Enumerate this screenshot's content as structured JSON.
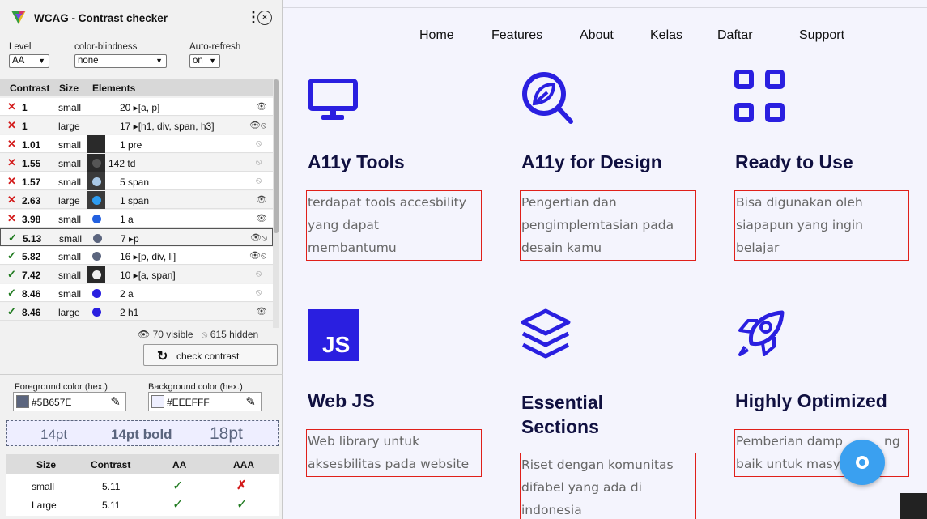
{
  "panel": {
    "title": "WCAG - Contrast checker",
    "level": {
      "label": "Level",
      "value": "AA"
    },
    "color_blindness": {
      "label": "color-blindness",
      "value": "none"
    },
    "auto_refresh": {
      "label": "Auto-refresh",
      "value": "on"
    },
    "columns": [
      "Contrast",
      "Size",
      "Elements"
    ],
    "rows": [
      {
        "status": "fail",
        "contrast": "1",
        "size": "small",
        "elements": "20 ▸[a, p]",
        "visibility": "visible"
      },
      {
        "status": "fail",
        "contrast": "1",
        "size": "large",
        "elements": "17 ▸[h1, div, span, h3]",
        "visibility": "both"
      },
      {
        "status": "fail",
        "contrast": "1.01",
        "size": "small",
        "elements": "1 pre",
        "visibility": "hidden"
      },
      {
        "status": "fail",
        "contrast": "1.55",
        "size": "small",
        "elements": "142 td",
        "visibility": "hidden"
      },
      {
        "status": "fail",
        "contrast": "1.57",
        "size": "small",
        "elements": "5 span",
        "visibility": "hidden"
      },
      {
        "status": "fail",
        "contrast": "2.63",
        "size": "large",
        "elements": "1 span",
        "visibility": "visible"
      },
      {
        "status": "fail",
        "contrast": "3.98",
        "size": "small",
        "elements": "1 a",
        "visibility": "visible"
      },
      {
        "status": "pass",
        "contrast": "5.13",
        "size": "small",
        "elements": "7 ▸p",
        "visibility": "both",
        "selected": true
      },
      {
        "status": "pass",
        "contrast": "5.82",
        "size": "small",
        "elements": "16 ▸[p, div, li]",
        "visibility": "both"
      },
      {
        "status": "pass",
        "contrast": "7.42",
        "size": "small",
        "elements": "10 ▸[a, span]",
        "visibility": "hidden"
      },
      {
        "status": "pass",
        "contrast": "8.46",
        "size": "small",
        "elements": "2 a",
        "visibility": "hidden"
      },
      {
        "status": "pass",
        "contrast": "8.46",
        "size": "large",
        "elements": "2 h1",
        "visibility": "visible"
      }
    ],
    "visible_count": "70 visible",
    "hidden_count": "615 hidden",
    "check_button": "check contrast",
    "foreground": {
      "label": "Foreground color (hex.)",
      "value": "#5B657E"
    },
    "background": {
      "label": "Background color (hex.)",
      "value": "#EEEFFF"
    },
    "preview": [
      "14pt",
      "14pt bold",
      "18pt"
    ],
    "result_columns": [
      "Size",
      "Contrast",
      "AA",
      "AAA"
    ],
    "results": [
      {
        "size": "small",
        "contrast": "5.11",
        "aa": "✓",
        "aaa": "✗"
      },
      {
        "size": "Large",
        "contrast": "5.11",
        "aa": "✓",
        "aaa": "✓"
      }
    ]
  },
  "site": {
    "nav": [
      "Home",
      "Features",
      "About",
      "Kelas",
      "Daftar",
      "Support"
    ],
    "cards": [
      {
        "icon": "monitor-icon",
        "title": "A11y Tools",
        "desc": [
          "terdapat tools accesbility",
          "yang dapat",
          "membantumu"
        ]
      },
      {
        "icon": "leaf-search-icon",
        "title": "A11y for Design",
        "desc": [
          "Pengertian dan",
          "pengimplemtasian pada",
          "desain kamu"
        ]
      },
      {
        "icon": "grid-icon",
        "title": "Ready to Use",
        "desc": [
          "Bisa digunakan oleh",
          "siapapun yang ingin",
          "belajar"
        ]
      },
      {
        "icon": "js-icon",
        "icon_text": "JS",
        "title": "Web JS",
        "desc": [
          "Web library untuk",
          "aksesbilitas pada website"
        ]
      },
      {
        "icon": "layers-icon",
        "title": "Essential Sections",
        "title_lines": [
          "Essential",
          "Sections"
        ],
        "desc": [
          "Riset dengan komunitas",
          "difabel yang ada di",
          "indonesia"
        ]
      },
      {
        "icon": "rocket-icon",
        "title": "Highly Optimized",
        "desc": [
          "Pemberian damp",
          "baik untuk masy"
        ],
        "desc_tail": "ng"
      }
    ],
    "accent_color": "#2a1fe0",
    "fab_icon": "eye-icon"
  }
}
